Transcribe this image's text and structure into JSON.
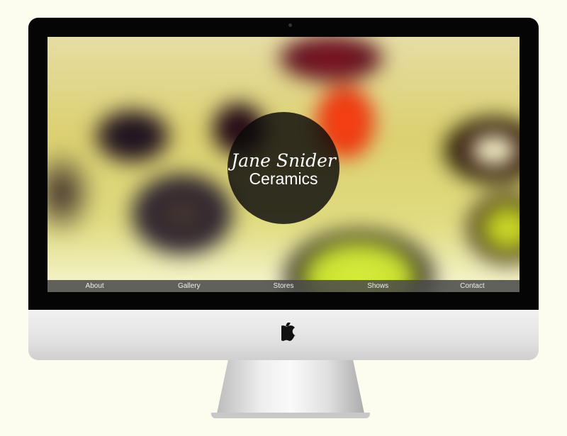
{
  "site": {
    "title_line1": "Jane Snider",
    "title_line2": "Ceramics"
  },
  "nav": [
    {
      "label": "About"
    },
    {
      "label": "Gallery"
    },
    {
      "label": "Stores"
    },
    {
      "label": "Shows"
    },
    {
      "label": "Contact"
    }
  ],
  "device": {
    "logo_icon": "apple-logo-icon"
  }
}
